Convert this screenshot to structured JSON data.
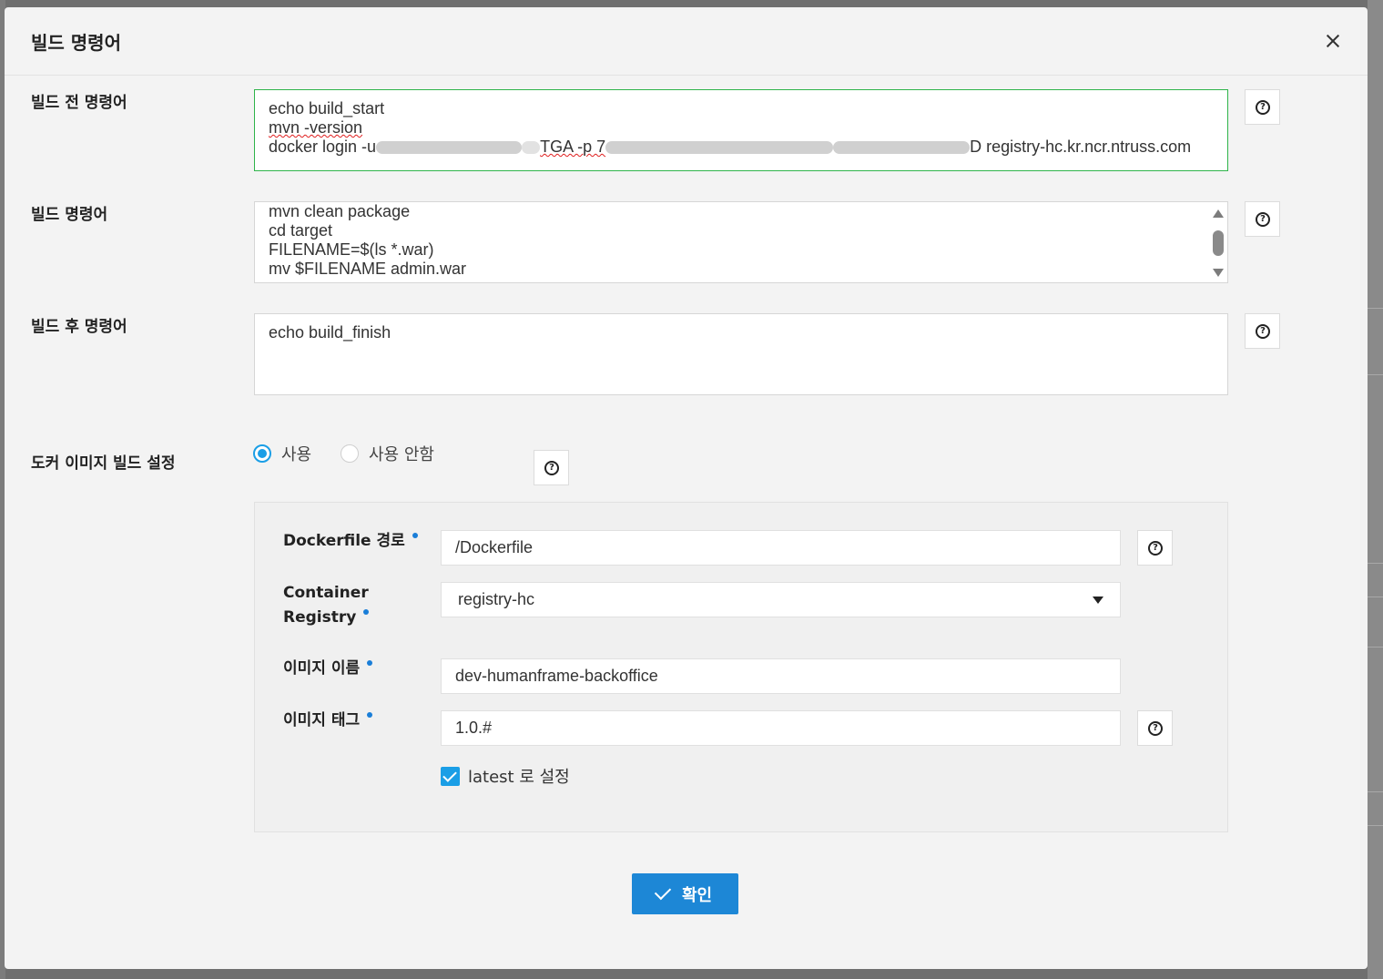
{
  "dialog": {
    "title": "빌드 명령어",
    "close_icon": "close-icon"
  },
  "pre_build": {
    "label": "빌드 전 명령어",
    "lines": [
      "echo build_start",
      "mvn -version",
      "docker login -u",
      "TGA -p 7",
      "D registry-hc.kr.ncr.ntruss.com"
    ]
  },
  "build": {
    "label": "빌드 명령어",
    "lines": [
      "mvn clean package",
      "cd target",
      "FILENAME=$(ls *.war)",
      "mv $FILENAME admin.war"
    ]
  },
  "post_build": {
    "label": "빌드 후 명령어",
    "lines": [
      "echo build_finish"
    ]
  },
  "docker": {
    "label": "도커 이미지 빌드 설정",
    "radio_use": "사용",
    "radio_not_use": "사용 안함",
    "selected": "사용",
    "dockerfile_label": "Dockerfile 경로",
    "dockerfile_value": "/Dockerfile",
    "registry_label_line1": "Container",
    "registry_label_line2": "Registry",
    "registry_value": "registry-hc",
    "image_name_label": "이미지 이름",
    "image_name_value": "dev-humanframe-backoffice",
    "image_tag_label": "이미지 태그",
    "image_tag_value": "1.0.#",
    "latest_label": "latest 로 설정",
    "latest_checked": true
  },
  "footer": {
    "confirm_label": "확인"
  },
  "colors": {
    "accent": "#1a9ee6",
    "primary_button": "#1d87d6",
    "focus_border": "#2eb44a"
  }
}
